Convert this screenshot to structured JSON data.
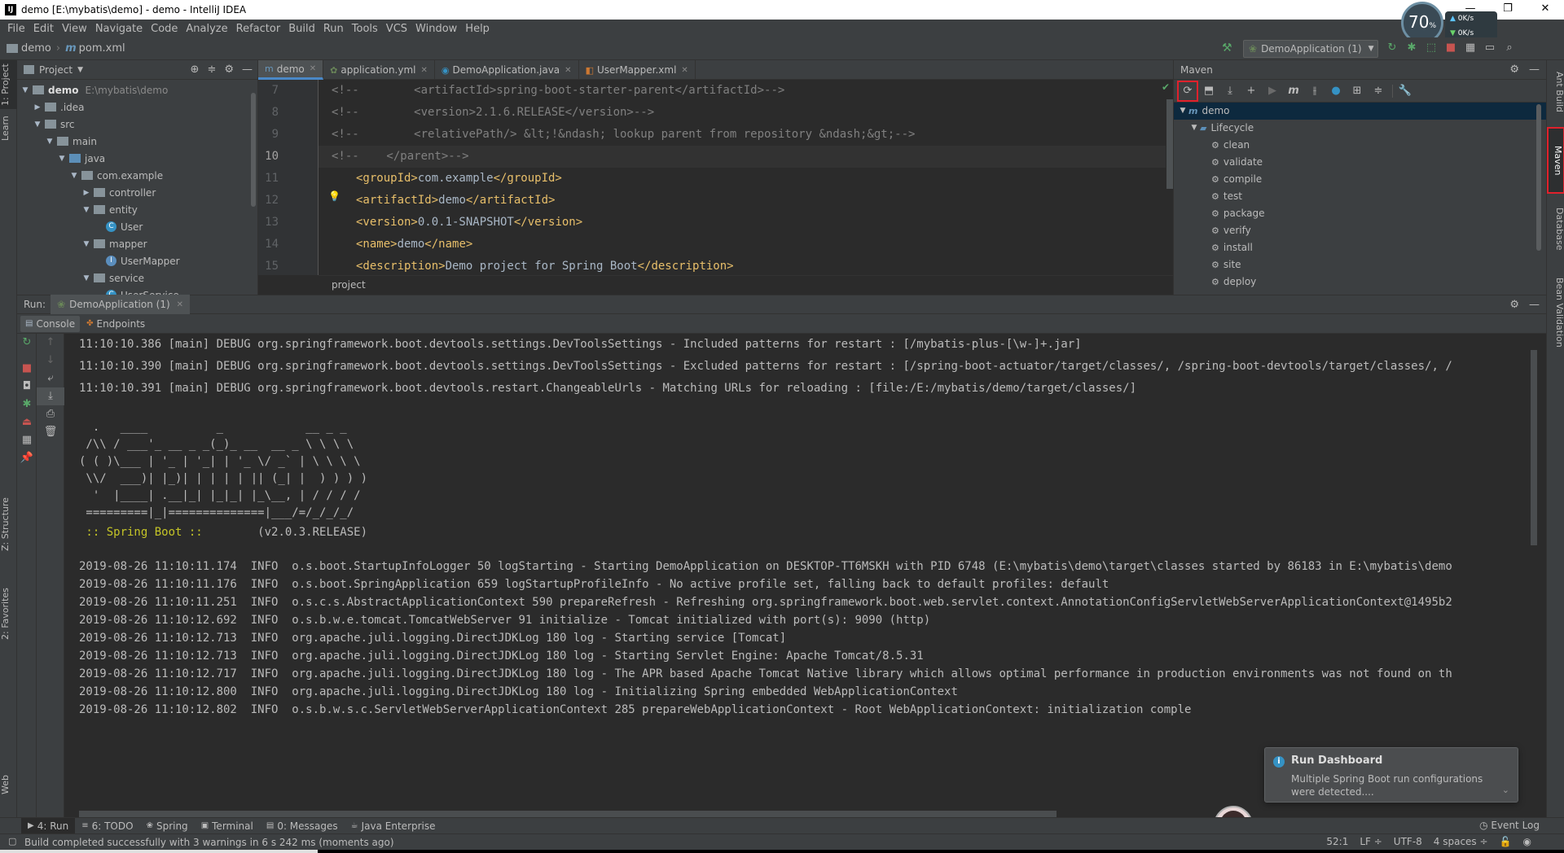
{
  "window": {
    "title": "demo [E:\\mybatis\\demo] - demo - IntelliJ IDEA",
    "app_icon": "IJ"
  },
  "net_widget": {
    "percent": "70",
    "unit": "%",
    "up_rate": "0K/s",
    "down_rate": "0K/s"
  },
  "menu": [
    "File",
    "Edit",
    "View",
    "Navigate",
    "Code",
    "Analyze",
    "Refactor",
    "Build",
    "Run",
    "Tools",
    "VCS",
    "Window",
    "Help"
  ],
  "breadcrumb": {
    "project": "demo",
    "file": "pom.xml"
  },
  "run_config": {
    "label": "DemoApplication (1)"
  },
  "left_strip": {
    "project_tab": "1: Project",
    "learn_tab": "Learn",
    "structure_tab": "Z: Structure",
    "favorites_tab": "2: Favorites",
    "web_tab": "Web"
  },
  "right_strip": {
    "ant_tab": "Ant Build",
    "maven_tab": "Maven",
    "database_tab": "Database",
    "bean_tab": "Bean Validation"
  },
  "project_panel": {
    "title": "Project",
    "tree": [
      {
        "label": "demo",
        "path": "E:\\mybatis\\demo",
        "depth": 0,
        "arrow": "▼",
        "kind": "folder"
      },
      {
        "label": ".idea",
        "depth": 1,
        "arrow": "▶",
        "kind": "folder"
      },
      {
        "label": "src",
        "depth": 1,
        "arrow": "▼",
        "kind": "folder"
      },
      {
        "label": "main",
        "depth": 2,
        "arrow": "▼",
        "kind": "folder"
      },
      {
        "label": "java",
        "depth": 3,
        "arrow": "▼",
        "kind": "folder-blue"
      },
      {
        "label": "com.example",
        "depth": 4,
        "arrow": "▼",
        "kind": "folder"
      },
      {
        "label": "controller",
        "depth": 5,
        "arrow": "▶",
        "kind": "folder"
      },
      {
        "label": "entity",
        "depth": 5,
        "arrow": "▼",
        "kind": "folder"
      },
      {
        "label": "User",
        "depth": 6,
        "arrow": "",
        "kind": "class"
      },
      {
        "label": "mapper",
        "depth": 5,
        "arrow": "▼",
        "kind": "folder"
      },
      {
        "label": "UserMapper",
        "depth": 6,
        "arrow": "",
        "kind": "interface"
      },
      {
        "label": "service",
        "depth": 5,
        "arrow": "▼",
        "kind": "folder"
      },
      {
        "label": "UserService",
        "depth": 6,
        "arrow": "",
        "kind": "class"
      }
    ]
  },
  "editor": {
    "tabs": [
      {
        "label": "demo",
        "icon": "m",
        "active": true
      },
      {
        "label": "application.yml",
        "icon": "yml",
        "active": false
      },
      {
        "label": "DemoApplication.java",
        "icon": "C",
        "active": false
      },
      {
        "label": "UserMapper.xml",
        "icon": "xml",
        "active": false
      }
    ],
    "line_numbers": [
      "7",
      "8",
      "9",
      "10",
      "11",
      "12",
      "13",
      "14",
      "15"
    ],
    "lines": [
      {
        "t": "comment",
        "text": "<!--        <artifactId>spring-boot-starter-parent</artifactId>-->"
      },
      {
        "t": "comment",
        "text": "<!--        <version>2.1.6.RELEASE</version>-->"
      },
      {
        "t": "comment",
        "text": "<!--        <relativePath/> &lt;!&ndash; lookup parent from repository &ndash;&gt;-->"
      },
      {
        "t": "comment",
        "text": "<!--    </parent>-->"
      },
      {
        "t": "xml",
        "open": "<groupId>",
        "value": "com.example",
        "close": "</groupId>"
      },
      {
        "t": "xml",
        "open": "<artifactId>",
        "value": "demo",
        "close": "</artifactId>"
      },
      {
        "t": "xml",
        "open": "<version>",
        "value": "0.0.1-SNAPSHOT",
        "close": "</version>"
      },
      {
        "t": "xml",
        "open": "<name>",
        "value": "demo",
        "close": "</name>"
      },
      {
        "t": "xml",
        "open": "<description>",
        "value": "Demo project for Spring Boot",
        "close": "</description>"
      }
    ],
    "breadcrumb": "project"
  },
  "maven_panel": {
    "title": "Maven",
    "project": "demo",
    "lifecycle": "Lifecycle",
    "goals": [
      "clean",
      "validate",
      "compile",
      "test",
      "package",
      "verify",
      "install",
      "site",
      "deploy"
    ]
  },
  "run_panel": {
    "label": "Run:",
    "tab": "DemoApplication (1)",
    "subtabs": [
      "Console",
      "Endpoints"
    ]
  },
  "console": {
    "debug_lines": [
      "11:10:10.386 [main] DEBUG org.springframework.boot.devtools.settings.DevToolsSettings - Included patterns for restart : [/mybatis-plus-[\\w-]+.jar]",
      "11:10:10.390 [main] DEBUG org.springframework.boot.devtools.settings.DevToolsSettings - Excluded patterns for restart : [/spring-boot-actuator/target/classes/, /spring-boot-devtools/target/classes/, /",
      "11:10:10.391 [main] DEBUG org.springframework.boot.devtools.restart.ChangeableUrls - Matching URLs for reloading : [file:/E:/mybatis/demo/target/classes/]"
    ],
    "banner": [
      "  .   ____          _            __ _ _",
      " /\\\\ / ___'_ __ _ _(_)_ __  __ _ \\ \\ \\ \\",
      "( ( )\\___ | '_ | '_| | '_ \\/ _` | \\ \\ \\ \\",
      " \\\\/  ___)| |_)| | | | | || (_| |  ) ) ) )",
      "  '  |____| .__|_| |_|_| |_\\__, | / / / /",
      " =========|_|==============|___/=/_/_/_/"
    ],
    "boot_label": " :: Spring Boot :: ",
    "boot_version": "       (v2.0.3.RELEASE)",
    "info_lines": [
      "2019-08-26 11:10:11.174  INFO  o.s.boot.StartupInfoLogger 50 logStarting - Starting DemoApplication on DESKTOP-TT6MSKH with PID 6748 (E:\\mybatis\\demo\\target\\classes started by 86183 in E:\\mybatis\\demo",
      "2019-08-26 11:10:11.176  INFO  o.s.boot.SpringApplication 659 logStartupProfileInfo - No active profile set, falling back to default profiles: default",
      "2019-08-26 11:10:11.251  INFO  o.s.c.s.AbstractApplicationContext 590 prepareRefresh - Refreshing org.springframework.boot.web.servlet.context.AnnotationConfigServletWebServerApplicationContext@1495b2",
      "2019-08-26 11:10:12.692  INFO  o.s.b.w.e.tomcat.TomcatWebServer 91 initialize - Tomcat initialized with port(s): 9090 (http)",
      "2019-08-26 11:10:12.713  INFO  org.apache.juli.logging.DirectJDKLog 180 log - Starting service [Tomcat]",
      "2019-08-26 11:10:12.713  INFO  org.apache.juli.logging.DirectJDKLog 180 log - Starting Servlet Engine: Apache Tomcat/8.5.31",
      "2019-08-26 11:10:12.717  INFO  org.apache.juli.logging.DirectJDKLog 180 log - The APR based Apache Tomcat Native library which allows optimal performance in production environments was not found on th",
      "2019-08-26 11:10:12.800  INFO  org.apache.juli.logging.DirectJDKLog 180 log - Initializing Spring embedded WebApplicationContext",
      "2019-08-26 11:10:12.802  INFO  o.s.b.w.s.c.ServletWebServerApplicationContext 285 prepareWebApplicationContext - Root WebApplicationContext: initialization comple"
    ]
  },
  "notification": {
    "title": "Run Dashboard",
    "message": "Multiple Spring Boot run configurations were detected...."
  },
  "bottom_tabs": [
    {
      "label": "4: Run",
      "icon": "▶",
      "active": true
    },
    {
      "label": "6: TODO",
      "icon": "≡",
      "active": false
    },
    {
      "label": "Spring",
      "icon": "❀",
      "active": false
    },
    {
      "label": "Terminal",
      "icon": "▣",
      "active": false
    },
    {
      "label": "0: Messages",
      "icon": "▤",
      "active": false
    },
    {
      "label": "Java Enterprise",
      "icon": "☕",
      "active": false
    }
  ],
  "event_log": "Event Log",
  "status": {
    "message": "Build completed successfully with 3 warnings in 6 s 242 ms (moments ago)",
    "position": "52:1",
    "line_sep": "LF ÷",
    "encoding": "UTF-8",
    "indent": "4 spaces ÷"
  },
  "colors": {
    "accent": "#4a88c7",
    "highlight": "#e0212c",
    "spring": "#6a8759",
    "tag": "#e8bf6a",
    "comment": "#808080",
    "boot_banner": "#c4c427"
  }
}
